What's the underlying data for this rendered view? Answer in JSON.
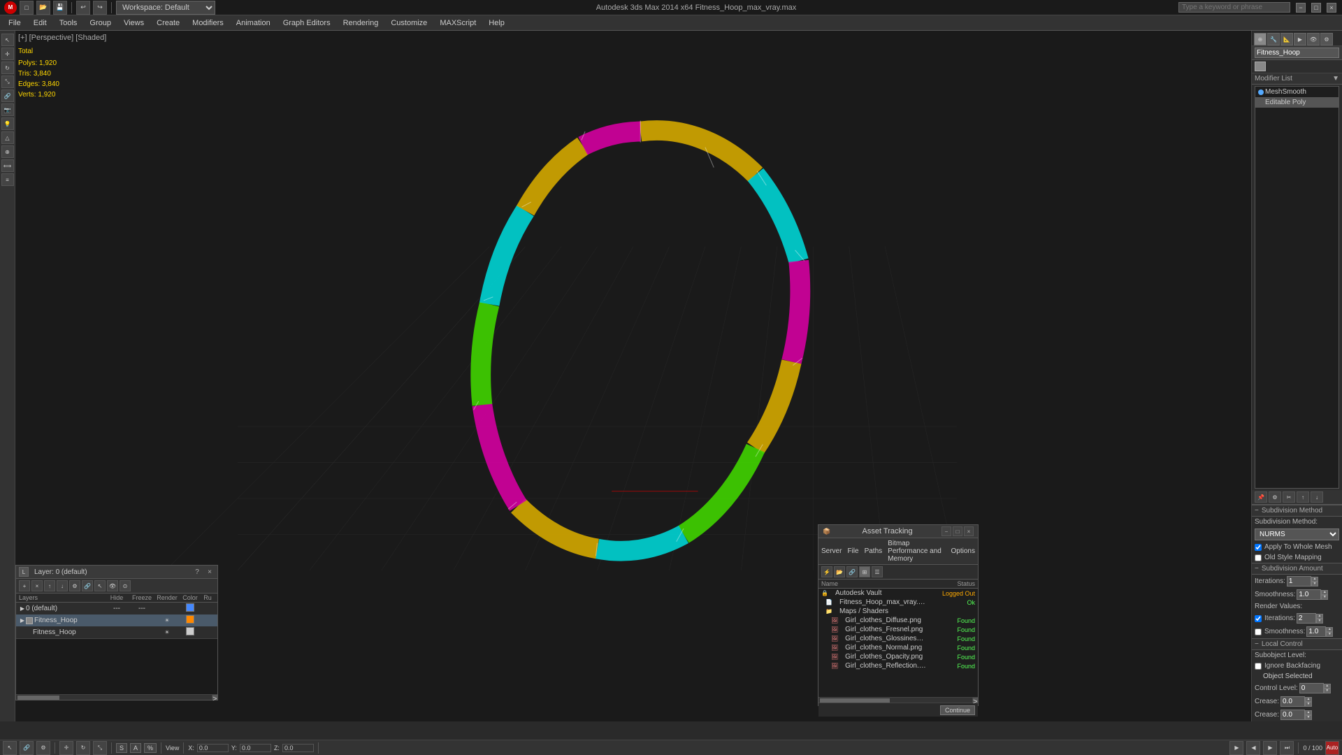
{
  "titlebar": {
    "title": "Autodesk 3ds Max 2014 x64    Fitness_Hoop_max_vray.max",
    "logo": "M",
    "workspace": "Workspace: Default",
    "search_placeholder": "Type a keyword or phrase",
    "close_label": "×",
    "maximize_label": "□",
    "minimize_label": "−"
  },
  "menubar": {
    "items": [
      "File",
      "Edit",
      "Tools",
      "Group",
      "Views",
      "Create",
      "Modifiers",
      "Animation",
      "Graph Editors",
      "Rendering",
      "Customize",
      "MAXScript",
      "Help"
    ]
  },
  "viewport": {
    "label": "[+] [Perspective] [Shaded]",
    "stats_label": "Total",
    "polys_label": "Polys:",
    "polys_value": "1,920",
    "tris_label": "Tris:",
    "tris_value": "3,840",
    "edges_label": "Edges:",
    "edges_value": "3,840",
    "verts_label": "Verts:",
    "verts_value": "1,920"
  },
  "modifier_panel": {
    "object_name": "Fitness_Hoop",
    "modifier_list_label": "Modifier List",
    "modifiers": [
      {
        "name": "MeshSmooth",
        "active": true
      },
      {
        "name": "Editable Poly",
        "active": true
      }
    ],
    "subdivision_method_header": "Subdivision Method",
    "subdivision_method_label": "Subdivision Method:",
    "subdivision_method_value": "NURMS",
    "apply_to_whole_mesh_label": "Apply To Whole Mesh",
    "apply_to_whole_mesh_checked": true,
    "old_style_mapping_label": "Old Style Mapping",
    "old_style_mapping_checked": false,
    "subdivision_amount_header": "Subdivision Amount",
    "iterations_label": "Iterations:",
    "iterations_value": "1",
    "smoothness_label": "Smoothness:",
    "smoothness_value": "1.0",
    "render_values_label": "Render Values:",
    "render_iterations_checked": true,
    "render_iterations_value": "2",
    "render_smoothness_label": "Smoothness:",
    "render_smoothness_value": "1.0",
    "local_control_header": "Local Control",
    "subobject_level_label": "Subobject Level:",
    "subobject_level_value": "",
    "ignore_backfacing_label": "Ignore Backfacing",
    "ignore_backfacing_checked": false,
    "object_selected_label": "Object Selected",
    "control_level_label": "Control Level:",
    "control_level_value": "0",
    "crease_label": "Crease:",
    "crease_value": "0.0"
  },
  "panel_tabs": {
    "icons": [
      "⚡",
      "🔧",
      "💡",
      "📷",
      "🔲",
      "⚙"
    ]
  },
  "layers_panel": {
    "title": "Layer: 0 (default)",
    "columns": [
      "Layers",
      "Hide",
      "Freeze",
      "Render",
      "Color",
      "Ru"
    ],
    "rows": [
      {
        "name": "0 (default)",
        "indent": 0,
        "hide": "---",
        "freeze": "---",
        "render": "",
        "color": "#4488ff",
        "active": false
      },
      {
        "name": "Fitness_Hoop",
        "indent": 1,
        "hide": "",
        "freeze": "",
        "render": "",
        "color": "#ff8800",
        "active": true,
        "selected": true
      },
      {
        "name": "Fitness_Hoop",
        "indent": 2,
        "hide": "",
        "freeze": "",
        "render": "",
        "color": "#cccccc",
        "active": false
      }
    ]
  },
  "asset_panel": {
    "title": "Asset Tracking",
    "menu_items": [
      "Server",
      "File",
      "Paths",
      "Bitmap Performance and Memory",
      "Options"
    ],
    "col_name": "Name",
    "col_status": "Status",
    "rows": [
      {
        "name": "Autodesk Vault",
        "indent": 0,
        "status": "Logged Out",
        "status_class": "status-logged-out",
        "icon": "🔒"
      },
      {
        "name": "Fitness_Hoop_max_vray.max",
        "indent": 1,
        "status": "Ok",
        "status_class": "status-ok",
        "icon": "📄"
      },
      {
        "name": "Maps / Shaders",
        "indent": 1,
        "status": "",
        "status_class": "",
        "icon": "📁"
      },
      {
        "name": "Girl_clothes_Diffuse.png",
        "indent": 2,
        "status": "Found",
        "status_class": "status-ok",
        "icon": "🖼"
      },
      {
        "name": "Girl_clothes_Fresnel.png",
        "indent": 2,
        "status": "Found",
        "status_class": "status-ok",
        "icon": "🖼"
      },
      {
        "name": "Girl_clothes_Glossiness.png",
        "indent": 2,
        "status": "Found",
        "status_class": "status-ok",
        "icon": "🖼"
      },
      {
        "name": "Girl_clothes_Normal.png",
        "indent": 2,
        "status": "Found",
        "status_class": "status-ok",
        "icon": "🖼"
      },
      {
        "name": "Girl_clothes_Opacity.png",
        "indent": 2,
        "status": "Found",
        "status_class": "status-ok",
        "icon": "🖼"
      },
      {
        "name": "Girl_clothes_Reflection.png",
        "indent": 2,
        "status": "Found",
        "status_class": "status-ok",
        "icon": "🖼"
      }
    ]
  },
  "colors": {
    "accent_blue": "#5af",
    "selected_blue": "#3366aa",
    "header_bg": "#333333",
    "panel_bg": "#2d2d2d",
    "dark_bg": "#1e1e1e"
  }
}
